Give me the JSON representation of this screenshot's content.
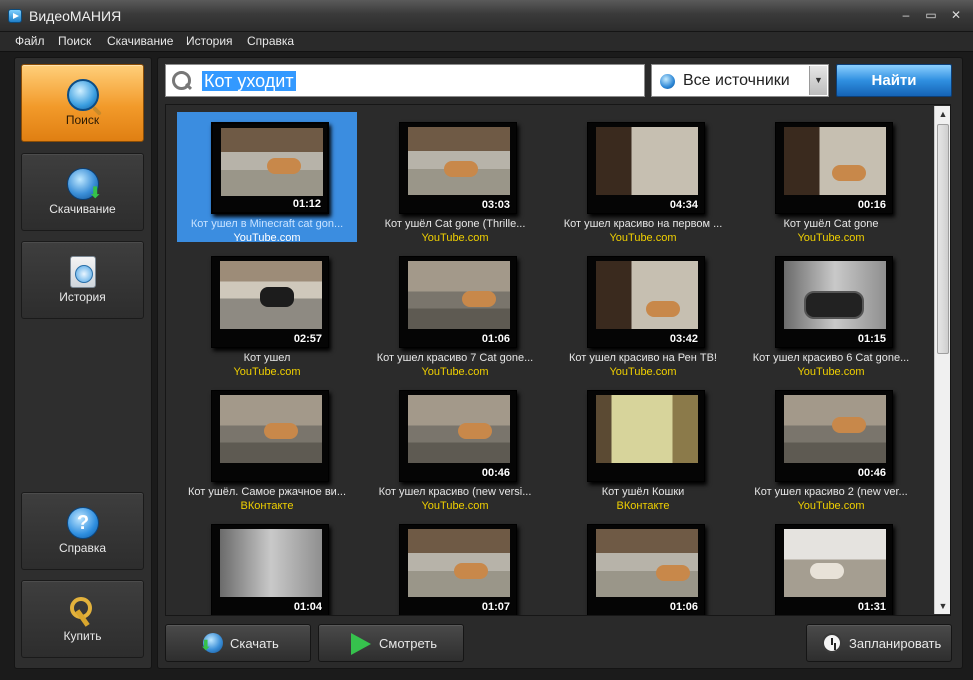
{
  "window": {
    "title": "ВидеоМАНИЯ",
    "min": "–",
    "max": "▭",
    "close": "✕"
  },
  "menu": [
    "Файл",
    "Поиск",
    "Скачивание",
    "История",
    "Справка"
  ],
  "sidebar": {
    "top": [
      {
        "label": "Поиск",
        "icon": "search-icon",
        "active": true
      },
      {
        "label": "Скачивание",
        "icon": "download-globe-icon",
        "active": false
      },
      {
        "label": "История",
        "icon": "history-icon",
        "active": false
      }
    ],
    "bottom": [
      {
        "label": "Справка",
        "icon": "help-icon"
      },
      {
        "label": "Купить",
        "icon": "keys-icon"
      }
    ]
  },
  "search": {
    "query": "Кот уходит",
    "source": "Все источники",
    "find_label": "Найти"
  },
  "results": [
    {
      "title": "Кот ушел в Minecraft cat gon...",
      "source": "YouTube.com",
      "duration": "01:12",
      "selected": true
    },
    {
      "title": "Кот ушёл  Cat gone (Thrille...",
      "source": "YouTube.com",
      "duration": "03:03"
    },
    {
      "title": "Кот ушел красиво на первом ...",
      "source": "YouTube.com",
      "duration": "04:34"
    },
    {
      "title": "Кот ушёл  Cat gone",
      "source": "YouTube.com",
      "duration": "00:16"
    },
    {
      "title": "Кот ушел",
      "source": "YouTube.com",
      "duration": "02:57"
    },
    {
      "title": "Кот ушел красиво 7 Cat gone...",
      "source": "YouTube.com",
      "duration": "01:06"
    },
    {
      "title": "Кот ушел красиво на Рен ТВ!",
      "source": "YouTube.com",
      "duration": "03:42"
    },
    {
      "title": "Кот ушел красиво 6 Cat gone...",
      "source": "YouTube.com",
      "duration": "01:15"
    },
    {
      "title": "Кот ушёл.  Самое ржачное ви...",
      "source": "ВКонтакте",
      "duration": ""
    },
    {
      "title": "Кот ушел красиво (new versi...",
      "source": "YouTube.com",
      "duration": "00:46"
    },
    {
      "title": "Кот ушёл Кошки",
      "source": "ВКонтакте",
      "duration": ""
    },
    {
      "title": "Кот ушел красиво 2 (new ver...",
      "source": "YouTube.com",
      "duration": "00:46"
    },
    {
      "title": "",
      "source": "",
      "duration": "01:04"
    },
    {
      "title": "",
      "source": "",
      "duration": "01:07"
    },
    {
      "title": "",
      "source": "",
      "duration": "01:06"
    },
    {
      "title": "",
      "source": "",
      "duration": "01:31"
    }
  ],
  "actions": {
    "download": "Скачать",
    "watch": "Смотреть",
    "schedule": "Запланировать"
  },
  "colors": {
    "accent": "#f29a2a",
    "selection": "#3b8de0",
    "source_text": "#f0d000",
    "find_button": "#2f8fe0"
  }
}
